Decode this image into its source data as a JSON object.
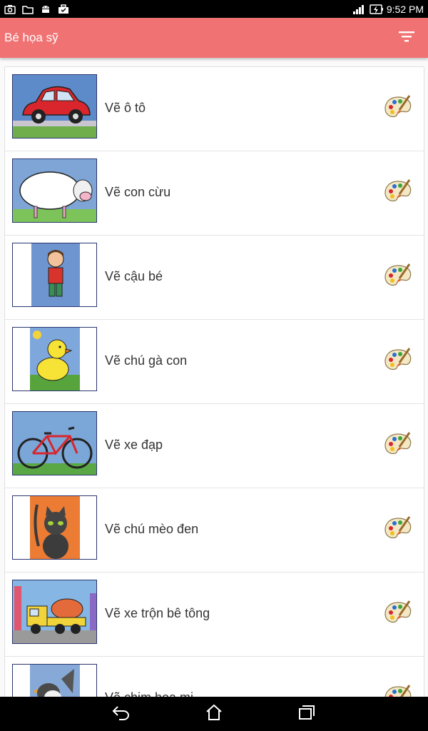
{
  "status_bar": {
    "time": "9:52 PM",
    "icons": [
      "screenshot-icon",
      "folder-icon",
      "android-icon",
      "briefcase-icon",
      "signal-icon",
      "battery-charging-icon"
    ]
  },
  "app_bar": {
    "title": "Bé họa sỹ",
    "filter_icon": "filter-icon"
  },
  "list": {
    "items": [
      {
        "label": "Vẽ ô tô",
        "thumbnail": "red-car"
      },
      {
        "label": "Vẽ con cừu",
        "thumbnail": "sheep"
      },
      {
        "label": "Vẽ cậu bé",
        "thumbnail": "boy"
      },
      {
        "label": "Vẽ chú gà con",
        "thumbnail": "chick"
      },
      {
        "label": "Vẽ xe đạp",
        "thumbnail": "bicycle"
      },
      {
        "label": "Vẽ chú mèo đen",
        "thumbnail": "black-cat"
      },
      {
        "label": "Vẽ xe trộn bê tông",
        "thumbnail": "cement-mixer"
      },
      {
        "label": "Vẽ chim họa mi",
        "thumbnail": "bird"
      }
    ],
    "action_icon": "paint-palette-icon"
  },
  "nav_bar": {
    "icons": [
      "back-icon",
      "home-icon",
      "recent-apps-icon"
    ]
  }
}
